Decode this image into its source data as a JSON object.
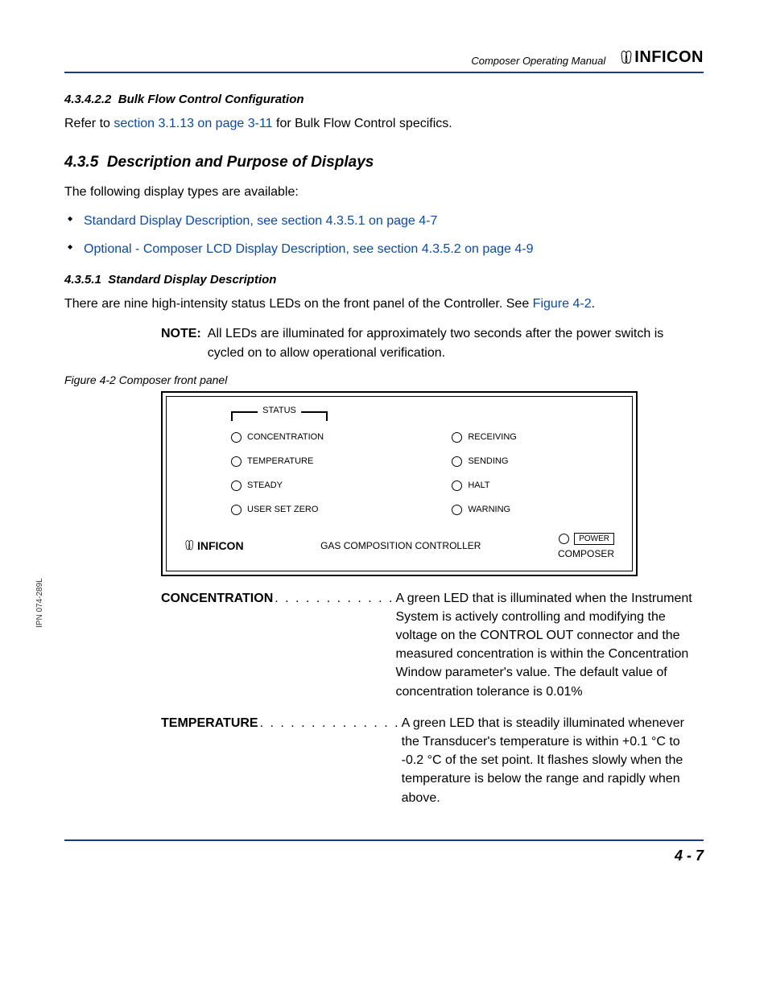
{
  "header": {
    "manual_title": "Composer Operating Manual",
    "brand": "INFICON"
  },
  "sections": {
    "s43422": {
      "num": "4.3.4.2.2",
      "title": "Bulk Flow Control Configuration",
      "text_pre": "Refer to ",
      "link": "section 3.1.13 on page 3-11",
      "text_post": " for Bulk Flow Control specifics."
    },
    "s435": {
      "num": "4.3.5",
      "title": "Description and Purpose of Displays",
      "intro": "The following display types are available:",
      "bullets": [
        "Standard Display Description, see section 4.3.5.1 on page 4-7",
        "Optional - Composer LCD Display Description, see section 4.3.5.2 on page 4-9"
      ]
    },
    "s4351": {
      "num": "4.3.5.1",
      "title": "Standard Display Description",
      "para_pre": "There are nine high-intensity status LEDs on the front panel of the Controller. See ",
      "para_link": "Figure 4-2",
      "para_post": ".",
      "note_label": "NOTE:",
      "note_text": "All LEDs are illuminated for approximately two seconds after the power switch is cycled on to allow operational verification."
    }
  },
  "figure": {
    "caption": "Figure 4-2  Composer front panel",
    "status_label": "STATUS",
    "leds_col1": [
      "CONCENTRATION",
      "TEMPERATURE",
      "STEADY",
      "USER SET ZERO"
    ],
    "leds_col2": [
      "RECEIVING",
      "SENDING",
      "HALT",
      "WARNING"
    ],
    "bottom_center": "GAS COMPOSITION CONTROLLER",
    "power": "POWER",
    "composer": "COMPOSER",
    "brand": "INFICON"
  },
  "definitions": [
    {
      "term": "CONCENTRATION",
      "dots": " . . . . . . . . . . . . ",
      "body": "A green LED that is illuminated when the Instrument System is actively controlling and modifying the voltage on the CONTROL OUT connector and the measured concentration is within the Concentration Window parameter's value. The default value of concentration tolerance is 0.01%"
    },
    {
      "term": "TEMPERATURE",
      "dots": " . . . . . . . . . . . . . . ",
      "body": "A green LED that is steadily illuminated whenever the Transducer's temperature is within +0.1 °C to -0.2 °C of the set point. It flashes slowly when the temperature is below the range and rapidly when above."
    }
  ],
  "side_label": "IPN 074-289L",
  "footer": "4 - 7"
}
